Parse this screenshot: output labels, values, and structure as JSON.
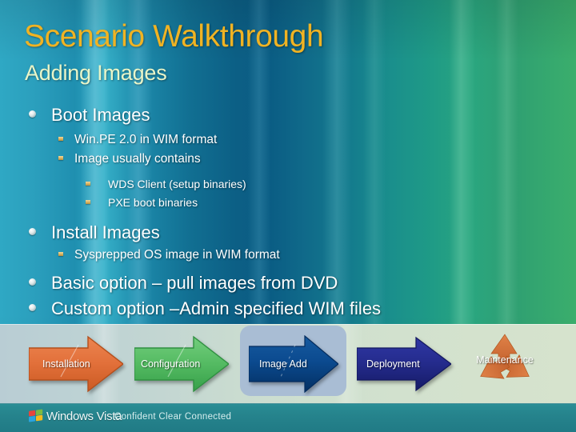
{
  "slide": {
    "title": "Scenario Walkthrough",
    "subtitle": "Adding Images",
    "title_color": "#f0b323",
    "subtitle_color": "#e9f5c8"
  },
  "content": [
    {
      "level": 1,
      "text": "Boot Images"
    },
    {
      "level": 2,
      "text": "Win.PE 2.0 in WIM format"
    },
    {
      "level": 2,
      "text": "Image usually contains"
    },
    {
      "level": 3,
      "text": "WDS Client (setup binaries)"
    },
    {
      "level": 3,
      "text": "PXE boot binaries"
    },
    {
      "level": 1,
      "text": "Install Images"
    },
    {
      "level": 2,
      "text": "Sysprepped OS image in WIM format"
    },
    {
      "level": 1,
      "text": "Basic option – pull images from DVD"
    },
    {
      "level": 1,
      "text": "Custom option –Admin specified WIM files"
    }
  ],
  "process_flow": {
    "steps": [
      {
        "label": "Installation",
        "color": "#e2703a",
        "shade": "#c4561f",
        "highlighted": false
      },
      {
        "label": "Configuration",
        "color": "#5cbd68",
        "shade": "#339944",
        "highlighted": false
      },
      {
        "label": "Image Add",
        "color": "#0b4a8f",
        "shade": "#04336b",
        "highlighted": true
      },
      {
        "label": "Deployment",
        "color": "#252c8e",
        "shade": "#161a68",
        "highlighted": false
      },
      {
        "label": "Maintenance",
        "color": "#d4703c",
        "shade": "#b8572a",
        "highlighted": false
      }
    ],
    "highlight_color": "#a9bdd4",
    "maintenance_icon": "recycle-icon"
  },
  "footer": {
    "brand": "Windows Vista",
    "tagline": "Confident Clear Connected",
    "logo_icon": "windows-flag-icon"
  }
}
